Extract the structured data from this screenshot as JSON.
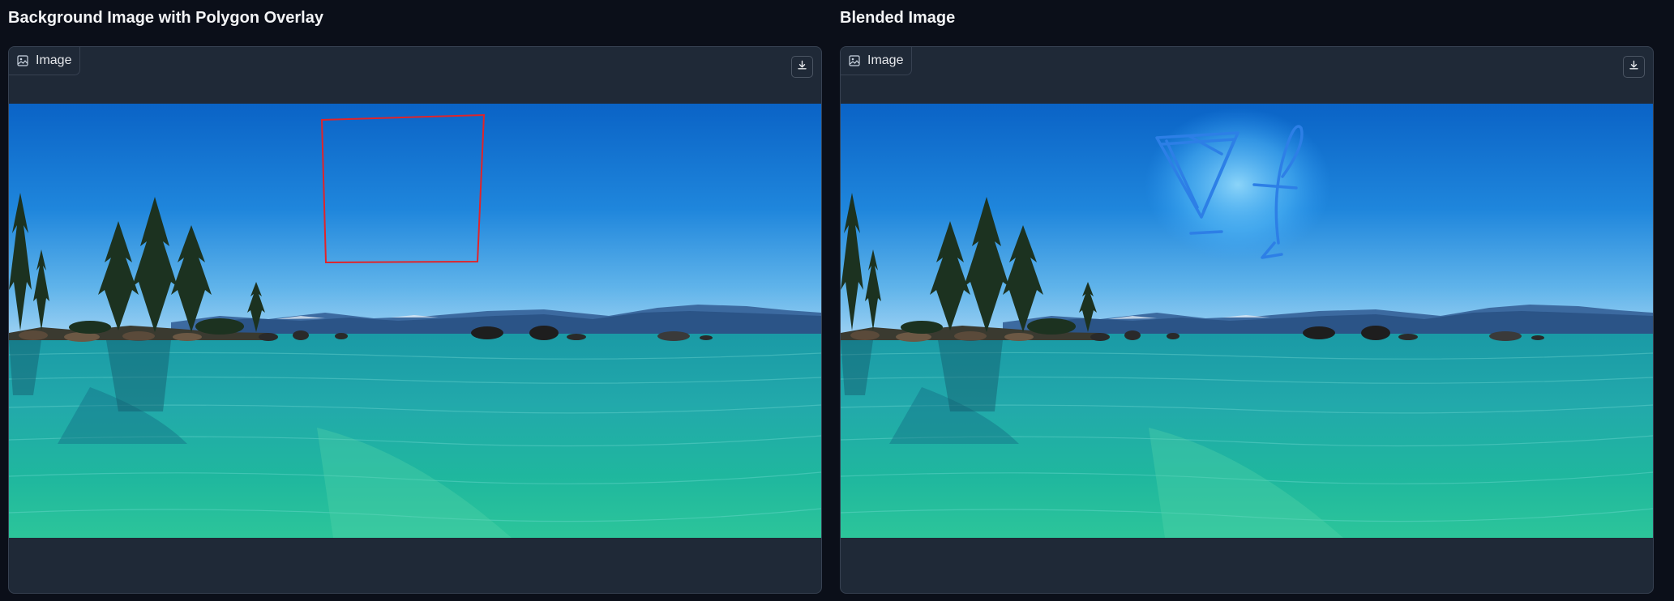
{
  "left_panel": {
    "heading": "Background Image with Polygon Overlay",
    "label": "Image",
    "label_icon": "image-icon",
    "download_icon": "download-icon"
  },
  "right_panel": {
    "heading": "Blended Image",
    "label": "Image",
    "label_icon": "image-icon",
    "download_icon": "download-icon"
  },
  "colors": {
    "page_background": "#0b0f19",
    "panel_background": "#1f2937",
    "panel_border": "#374151",
    "polygon_stroke": "#e0242a",
    "scribble_stroke": "#2d7fe6"
  }
}
